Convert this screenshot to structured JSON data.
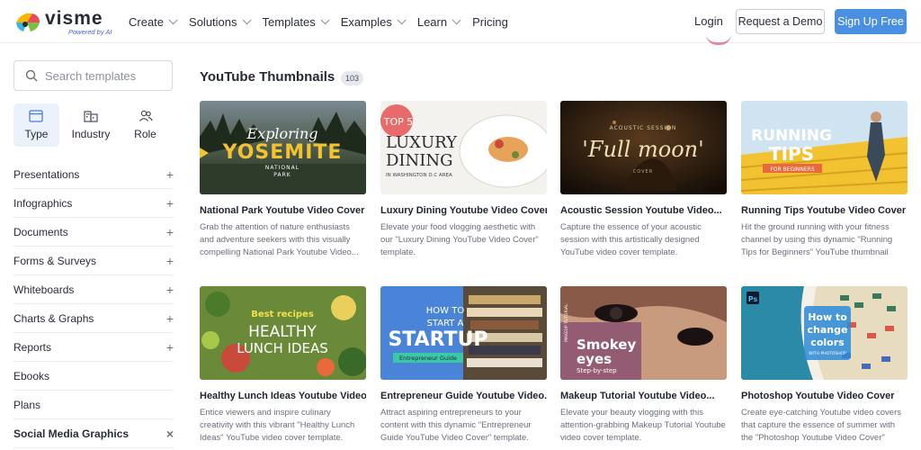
{
  "header": {
    "logo_text": "visme",
    "logo_sub": "Powered by AI",
    "nav": [
      {
        "label": "Create",
        "dropdown": true
      },
      {
        "label": "Solutions",
        "dropdown": true
      },
      {
        "label": "Templates",
        "dropdown": true
      },
      {
        "label": "Examples",
        "dropdown": true
      },
      {
        "label": "Learn",
        "dropdown": true
      },
      {
        "label": "Pricing",
        "dropdown": false
      }
    ],
    "login": "Login",
    "demo": "Request a Demo",
    "signup": "Sign Up Free",
    "accent_color": "#4a90e2"
  },
  "sidebar": {
    "search_placeholder": "Search templates",
    "tabs": [
      {
        "label": "Type",
        "icon": "window-icon",
        "active": true
      },
      {
        "label": "Industry",
        "icon": "buildings-icon",
        "active": false
      },
      {
        "label": "Role",
        "icon": "users-icon",
        "active": false
      }
    ],
    "categories": [
      {
        "label": "Presentations",
        "sign": "+"
      },
      {
        "label": "Infographics",
        "sign": "+"
      },
      {
        "label": "Documents",
        "sign": "+"
      },
      {
        "label": "Forms & Surveys",
        "sign": "+"
      },
      {
        "label": "Whiteboards",
        "sign": "+"
      },
      {
        "label": "Charts & Graphs",
        "sign": "+"
      },
      {
        "label": "Reports",
        "sign": "+"
      },
      {
        "label": "Ebooks",
        "sign": ""
      },
      {
        "label": "Plans",
        "sign": ""
      },
      {
        "label": "Social Media Graphics",
        "sign": "×"
      }
    ]
  },
  "main": {
    "title": "YouTube Thumbnails",
    "count": "103",
    "cards": [
      {
        "title": "National Park Youtube Video Cover",
        "desc": "Grab the attention of nature enthusiasts and adventure seekers with this visually compelling National Park Youtube Video...",
        "thumb": {
          "l1": "Exploring",
          "l2": "YOSEMITE",
          "l3": "NATIONAL",
          "l4": "PARK"
        }
      },
      {
        "title": "Luxury Dining Youtube Video Cover",
        "desc": "Elevate your food vlogging aesthetic with our \"Luxury Dining YouTube Video Cover\" template.",
        "thumb": {
          "l1": "TOP 5",
          "l2": "LUXURY",
          "l3": "DINING",
          "l4": "IN WASHINGTON D.C AREA"
        }
      },
      {
        "title": "Acoustic Session Youtube Video...",
        "desc": "Capture the essence of your acoustic session with this artistically designed YouTube video cover template.",
        "thumb": {
          "l1": "ACOUSTIC SESSION",
          "l2": "'Full moon'",
          "l3": "COVER",
          "l4": ""
        }
      },
      {
        "title": "Running Tips Youtube Video Cover",
        "desc": "Hit the ground running with your fitness channel by using this dynamic \"Running Tips for Beginners\" YouTube thumbnail template.",
        "thumb": {
          "l1": "RUNNING",
          "l2": "TIPS",
          "l3": "FOR BEGINNERS",
          "l4": ""
        }
      },
      {
        "title": "Healthy Lunch Ideas Youtube Video...",
        "desc": "Entice viewers and inspire culinary creativity with this vibrant \"Healthy Lunch Ideas\" YouTube video cover template.",
        "thumb": {
          "l1": "Best recipes",
          "l2": "HEALTHY",
          "l3": "LUNCH IDEAS",
          "l4": ""
        }
      },
      {
        "title": "Entrepreneur Guide Youtube Video...",
        "desc": "Attract aspiring entrepreneurs to your content with this dynamic \"Entrepreneur Guide YouTube Video Cover\" template.",
        "thumb": {
          "l1": "HOW TO",
          "l2": "START A",
          "l3": "STARTUP",
          "l4": "Entrepreneur Guide"
        }
      },
      {
        "title": "Makeup Tutorial Youtube Video...",
        "desc": "Elevate your beauty vlogging with this attention-grabbing Makeup Tutorial Youtube video cover template.",
        "thumb": {
          "l1": "Smokey",
          "l2": "eyes",
          "l3": "Step-by-step",
          "l4": "MAKEUP TUTORIAL"
        }
      },
      {
        "title": "Photoshop Youtube Video Cover",
        "desc": "Create eye-catching Youtube video covers that capture the essence of summer with the \"Photoshop Youtube Video Cover\" template.",
        "thumb": {
          "l1": "Ps",
          "l2": "How to",
          "l3": "change",
          "l4": "colors",
          "l5": "WITH PHOTOSHOP"
        }
      }
    ]
  }
}
